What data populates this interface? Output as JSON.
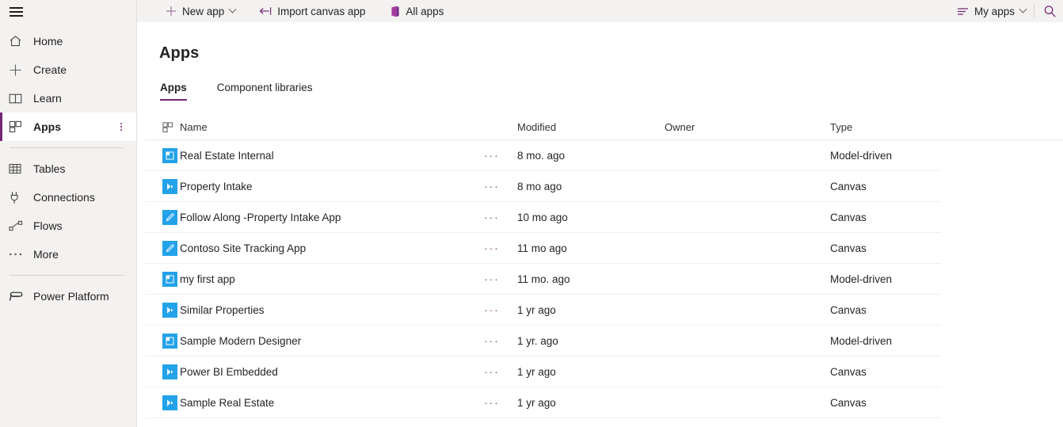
{
  "sidebar": {
    "menu_icon": "hamburger-icon",
    "items": [
      {
        "label": "Home",
        "icon": "home-icon"
      },
      {
        "label": "Create",
        "icon": "plus-icon"
      },
      {
        "label": "Learn",
        "icon": "book-icon"
      },
      {
        "label": "Apps",
        "icon": "apps-grid-icon",
        "selected": true,
        "overflow": "more-options-icon"
      },
      {
        "label": "Tables",
        "icon": "table-icon"
      },
      {
        "label": "Connections",
        "icon": "plug-icon"
      },
      {
        "label": "Flows",
        "icon": "flow-icon"
      },
      {
        "label": "More",
        "icon": "ellipsis-icon"
      },
      {
        "label": "Power Platform",
        "icon": "power-platform-icon"
      }
    ]
  },
  "toolbar": {
    "new_app_label": "New app",
    "import_canvas_label": "Import canvas app",
    "all_apps_label": "All apps",
    "my_apps_label": "My apps",
    "filter_icon": "filter-list-icon",
    "search_icon": "search-icon",
    "new_app_icon": "plus-icon",
    "import_icon": "import-arrow-icon",
    "all_apps_icon": "office-apps-icon"
  },
  "page": {
    "title": "Apps",
    "tabs": [
      {
        "label": "Apps",
        "active": true
      },
      {
        "label": "Component libraries",
        "active": false
      }
    ]
  },
  "table": {
    "columns": {
      "icon": "",
      "name": "Name",
      "modified": "Modified",
      "owner": "Owner",
      "type": "Type"
    },
    "header_icon": "apps-grid-icon",
    "row_overflow_icon": "ellipsis-icon",
    "icon_color": "#22a2e8",
    "rows": [
      {
        "icon": "model-driven-app-icon",
        "name": "Real Estate Internal",
        "dots": "···",
        "modified": "8 mo. ago",
        "owner": "",
        "type": "Model-driven"
      },
      {
        "icon": "canvas-app-icon",
        "name": "Property Intake",
        "dots": "···",
        "modified": "8 mo ago",
        "owner": "",
        "type": "Canvas"
      },
      {
        "icon": "canvas-pen-app-icon",
        "name": "Follow Along -Property Intake App",
        "dots": "···",
        "modified": "10 mo ago",
        "owner": "",
        "type": "Canvas"
      },
      {
        "icon": "canvas-pen-app-icon",
        "name": "Contoso Site Tracking App",
        "dots": "···",
        "modified": "11 mo ago",
        "owner": "",
        "type": "Canvas"
      },
      {
        "icon": "model-driven-app-icon",
        "name": "my first app",
        "dots": "···",
        "modified": "11 mo. ago",
        "owner": "",
        "type": "Model-driven"
      },
      {
        "icon": "canvas-app-icon",
        "name": "Similar Properties",
        "dots": "···",
        "modified": "1 yr ago",
        "owner": "",
        "type": "Canvas"
      },
      {
        "icon": "model-driven-app-icon",
        "name": "Sample Modern Designer",
        "dots": "···",
        "modified": "1 yr. ago",
        "owner": "",
        "type": "Model-driven"
      },
      {
        "icon": "canvas-app-icon",
        "name": "Power BI Embedded",
        "dots": "···",
        "modified": "1 yr ago",
        "owner": "",
        "type": "Canvas"
      },
      {
        "icon": "canvas-app-icon",
        "name": "Sample Real Estate",
        "dots": "···",
        "modified": "1 yr ago",
        "owner": "",
        "type": "Canvas"
      }
    ]
  },
  "theme": {
    "accent": "#742774",
    "sidebar_bg": "#f3f2f1",
    "app_icon_blue": "#22a2e8"
  }
}
